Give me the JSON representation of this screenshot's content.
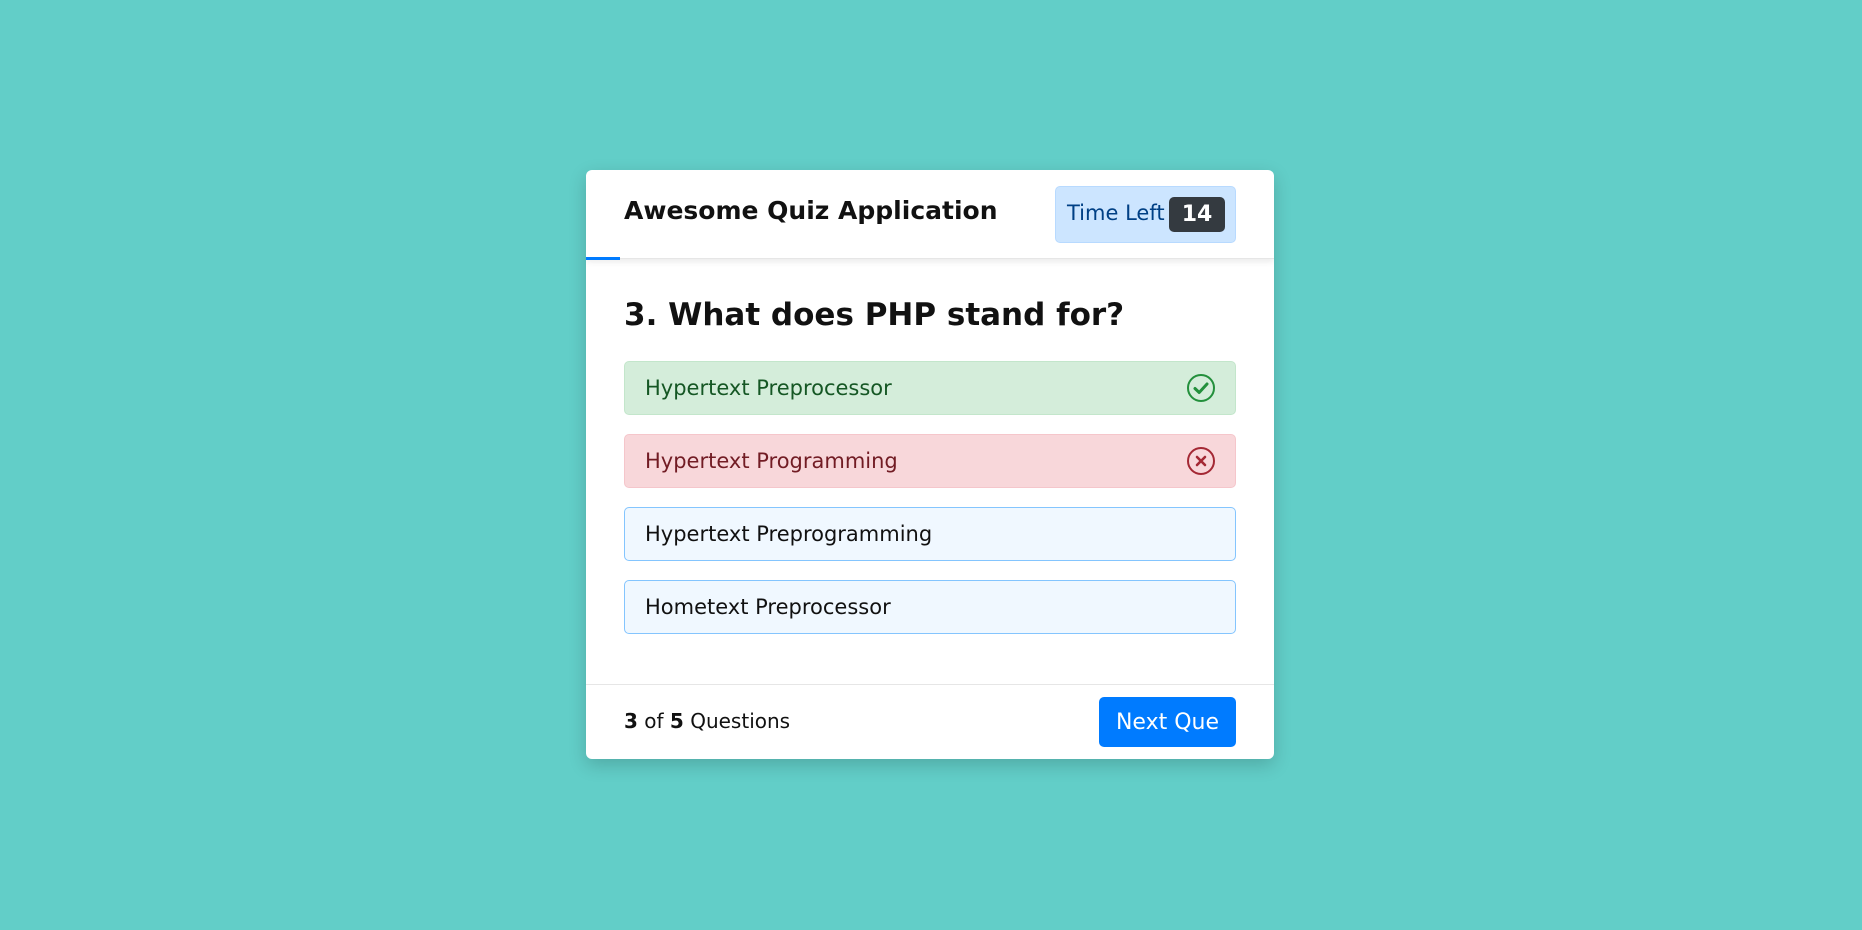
{
  "header": {
    "title": "Awesome Quiz Application",
    "timer_label": "Time Left",
    "timer_seconds": "14",
    "time_progress": 0.05
  },
  "question": {
    "text": "3. What does PHP stand for?",
    "options": [
      {
        "label": "Hypertext Preprocessor",
        "state": "correct",
        "icon": "check-circle-icon"
      },
      {
        "label": "Hypertext Programming",
        "state": "incorrect",
        "icon": "x-circle-icon"
      },
      {
        "label": "Hypertext Preprogramming",
        "state": "default"
      },
      {
        "label": "Hometext Preprocessor",
        "state": "default"
      }
    ]
  },
  "footer": {
    "current": "3",
    "of": "of",
    "total": "5",
    "suffix": "Questions",
    "next_label": "Next Que"
  },
  "colors": {
    "background": "#62cec8",
    "accent": "#007bff",
    "correct_bg": "#d4edda",
    "incorrect_bg": "#f8d7da",
    "option_bg": "#f0f8ff"
  }
}
